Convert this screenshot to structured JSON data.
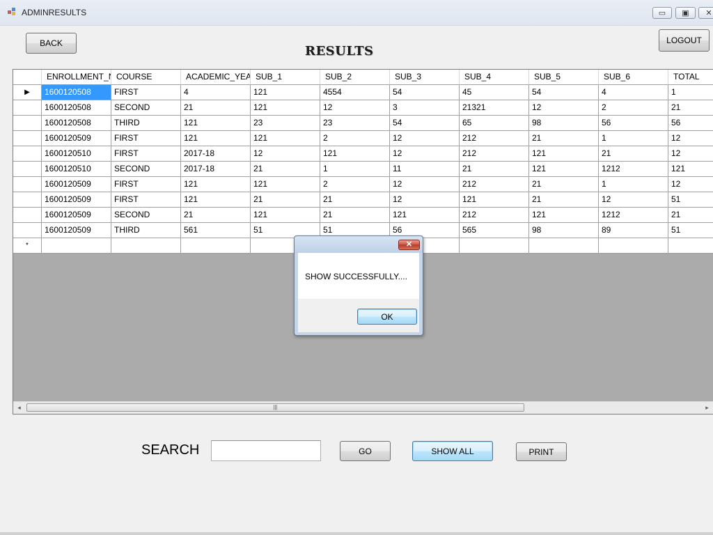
{
  "window": {
    "title": "ADMINRESULTS",
    "controls": {
      "minimize": "▭",
      "maximize": "▣",
      "close": "✕"
    }
  },
  "toolbar": {
    "back_label": "BACK",
    "logout_label": "LOGOUT"
  },
  "page": {
    "heading": "RESULTS"
  },
  "grid": {
    "columns": [
      "ENROLLMENT_NO",
      "COURSE",
      "ACADEMIC_YEAR",
      "SUB_1",
      "SUB_2",
      "SUB_3",
      "SUB_4",
      "SUB_5",
      "SUB_6",
      "TOTAL"
    ],
    "rows": [
      [
        "1600120508",
        "FIRST",
        "4",
        "121",
        "4554",
        "54",
        "45",
        "54",
        "4",
        "1"
      ],
      [
        "1600120508",
        "SECOND",
        "21",
        "121",
        "12",
        "3",
        "21321",
        "12",
        "2",
        "21"
      ],
      [
        "1600120508",
        "THIRD",
        "121",
        "23",
        "23",
        "54",
        "65",
        "98",
        "56",
        "56"
      ],
      [
        "1600120509",
        "FIRST",
        "121",
        "121",
        "2",
        "12",
        "212",
        "21",
        "1",
        "12"
      ],
      [
        "1600120510",
        "FIRST",
        "2017-18",
        "12",
        "121",
        "12",
        "212",
        "121",
        "21",
        "12"
      ],
      [
        "1600120510",
        "SECOND",
        "2017-18",
        "21",
        "1",
        "11",
        "21",
        "121",
        "1212",
        "121"
      ],
      [
        "1600120509",
        "FIRST",
        "121",
        "121",
        "2",
        "12",
        "212",
        "21",
        "1",
        "12"
      ],
      [
        "1600120509",
        "FIRST",
        "121",
        "21",
        "21",
        "12",
        "121",
        "21",
        "12",
        "51"
      ],
      [
        "1600120509",
        "SECOND",
        "21",
        "121",
        "21",
        "121",
        "212",
        "121",
        "1212",
        "21"
      ],
      [
        "1600120509",
        "THIRD",
        "561",
        "51",
        "51",
        "56",
        "565",
        "98",
        "89",
        "51"
      ]
    ],
    "current_row_marker": "▶",
    "new_row_marker": "*",
    "scrollbar": {
      "left_arrow": "◂",
      "right_arrow": "▸",
      "grip": "|||"
    }
  },
  "dialog": {
    "message": "SHOW SUCCESSFULLY....",
    "ok_label": "OK",
    "close_glyph": "✕"
  },
  "search": {
    "label": "SEARCH",
    "value": "",
    "placeholder": "",
    "go_label": "GO",
    "show_all_label": "SHOW ALL",
    "print_label": "PRINT"
  },
  "colors": {
    "selection": "#3399ff",
    "grid_background": "#ababab",
    "dialog_frame": "#c5d6ea"
  }
}
